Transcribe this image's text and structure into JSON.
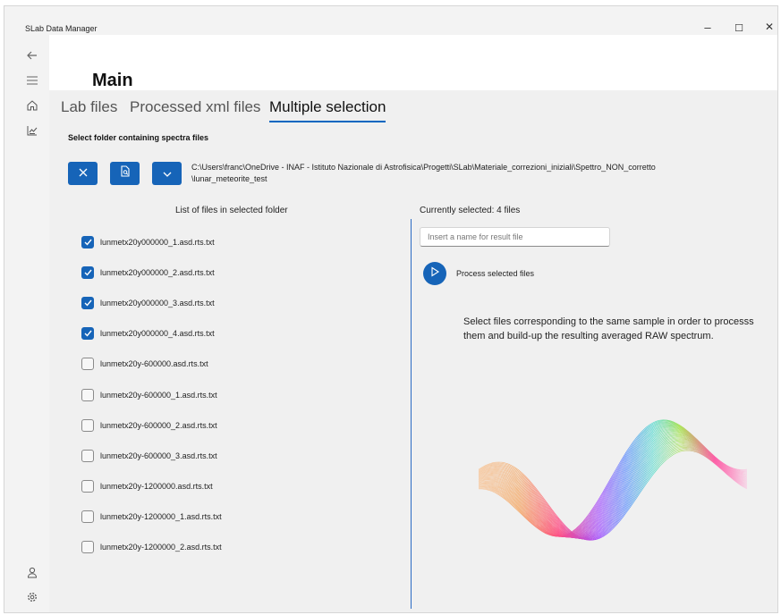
{
  "app": {
    "title": "SLab Data Manager"
  },
  "window_controls": {
    "minimize": "–",
    "maximize": "☐",
    "close": "✕"
  },
  "nav": {
    "back_icon": "back-arrow-icon",
    "menu_icon": "hamburger-icon",
    "home_icon": "home-icon",
    "data_icon": "chart-icon",
    "account_icon": "person-icon",
    "settings_icon": "gear-icon"
  },
  "page": {
    "title": "Main"
  },
  "tabs": [
    {
      "label": "Lab files",
      "active": false
    },
    {
      "label": "Processed xml files",
      "active": false
    },
    {
      "label": "Multiple selection",
      "active": true
    }
  ],
  "folder": {
    "section_label": "Select folder containing spectra files",
    "path_line1": "C:\\Users\\franc\\OneDrive - INAF - Istituto Nazionale di Astrofisica\\Progetti\\SLab\\Materiale_correzioni_iniziali\\Spettro_NON_corretto",
    "path_line2": "\\lunar_meteorite_test",
    "buttons": [
      "close-icon",
      "folder-search-icon",
      "chevron-down-icon"
    ]
  },
  "file_list": {
    "header": "List of files in selected folder",
    "files": [
      {
        "name": "lunmetx20y000000_1.asd.rts.txt",
        "checked": true
      },
      {
        "name": "lunmetx20y000000_2.asd.rts.txt",
        "checked": true
      },
      {
        "name": "lunmetx20y000000_3.asd.rts.txt",
        "checked": true
      },
      {
        "name": "lunmetx20y000000_4.asd.rts.txt",
        "checked": true
      },
      {
        "name": "lunmetx20y-600000.asd.rts.txt",
        "checked": false
      },
      {
        "name": "lunmetx20y-600000_1.asd.rts.txt",
        "checked": false
      },
      {
        "name": "lunmetx20y-600000_2.asd.rts.txt",
        "checked": false
      },
      {
        "name": "lunmetx20y-600000_3.asd.rts.txt",
        "checked": false
      },
      {
        "name": "lunmetx20y-1200000.asd.rts.txt",
        "checked": false
      },
      {
        "name": "lunmetx20y-1200000_1.asd.rts.txt",
        "checked": false
      },
      {
        "name": "lunmetx20y-1200000_2.asd.rts.txt",
        "checked": false
      }
    ]
  },
  "selection": {
    "header": "Currently selected: 4 files",
    "result_placeholder": "Insert a name for result file",
    "result_value": "",
    "process_label": "Process selected files",
    "help_text": "Select files corresponding to the same sample in order to processs them and build-up the resulting averaged RAW spectrum."
  },
  "colors": {
    "accent": "#1664b8",
    "divider": "#2b6bc4"
  }
}
